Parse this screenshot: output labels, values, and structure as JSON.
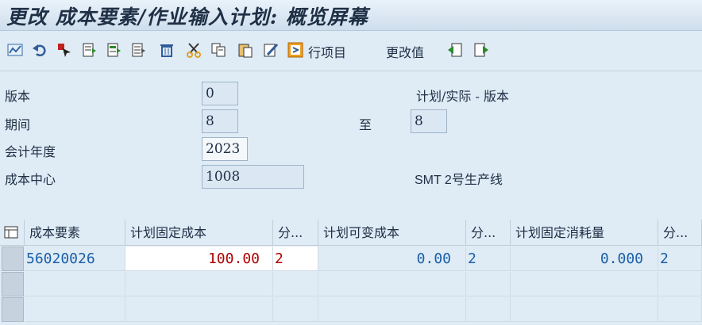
{
  "window": {
    "title": "更改 成本要素/作业输入计划: 概览屏幕"
  },
  "toolbar": {
    "icons": [
      "chart-icon",
      "undo-icon",
      "cursor-select-icon",
      "doc-icon",
      "doc-green-icon",
      "doc-list-icon",
      "trash-icon",
      "cut-icon",
      "copy-icon",
      "paste-icon",
      "edit-icon",
      "row-items-icon",
      "previous-icon",
      "next-icon"
    ],
    "line_items_label": "行项目",
    "change_values_label": "更改值"
  },
  "form": {
    "version_label": "版本",
    "version_value": "0",
    "plan_actual_label": "计划/实际 - 版本",
    "period_label": "期间",
    "period_value": "8",
    "to_label": "至",
    "to_value": "8",
    "fiscal_year_label": "会计年度",
    "fiscal_year_value": "2023",
    "cost_center_label": "成本中心",
    "cost_center_value": "1008",
    "cost_center_desc": "SMT 2号生产线"
  },
  "table": {
    "headers": [
      "成本要素",
      "计划固定成本",
      "分...",
      "计划可变成本",
      "分...",
      "计划固定消耗量",
      "分..."
    ],
    "rows": [
      {
        "cost_element": "56020026",
        "fixed_cost": "100.00",
        "dist1": "2",
        "variable_cost": "0.00",
        "dist2": "2",
        "fixed_consumption": "0.000",
        "dist3": "2"
      }
    ]
  },
  "colors": {
    "blue_text": "#1a5fa8",
    "red_text": "#b00000"
  }
}
